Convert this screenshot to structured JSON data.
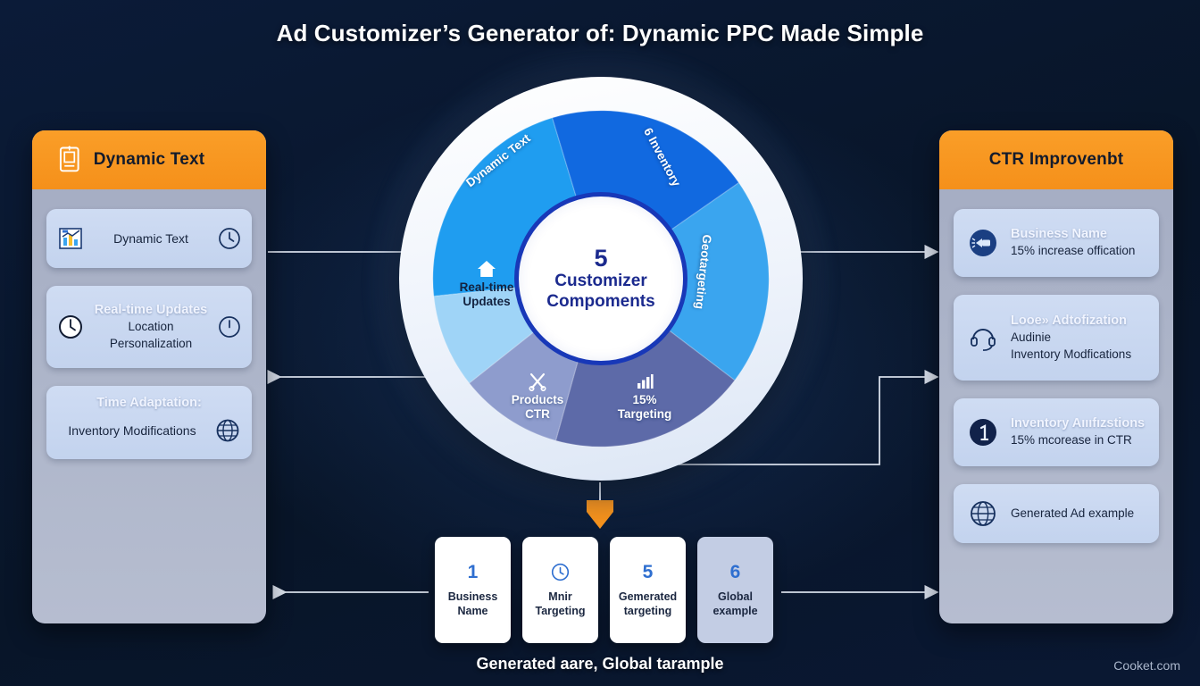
{
  "title": "Ad Customizer’s Generator of: Dynamic PPC Made Simple",
  "watermark": "Cooket.com",
  "colors": {
    "background": "#0a1833",
    "accent_orange": "#f7941e",
    "panel_body": "#a9b1c6",
    "card_blue": "#c8d7f0",
    "hub_border": "#1838b8",
    "hub_text": "#1b2a8e",
    "segment_1": "#1f9df0",
    "segment_2": "#1169e0",
    "segment_3": "#4fb3f2",
    "segment_4": "#5d6aa8",
    "segment_5": "#9fc9f0"
  },
  "left_panel": {
    "header": {
      "title": "Dynamic Text",
      "icon": "document-icon"
    },
    "cards": [
      {
        "id": "dynamic-text",
        "label": "Dynamic Text",
        "left_icon": "bar-chart-icon",
        "right_icon": "clock-icon"
      },
      {
        "id": "real-time-updates",
        "ghost_title": "Real-time Updates",
        "lines": [
          "Location",
          "Personalization"
        ],
        "left_icon": "clock-icon",
        "right_icon": "clock-icon"
      },
      {
        "id": "time-adaptation",
        "ghost_title": "Time Adaptation:",
        "lines": [
          "Inventory  Modifications"
        ],
        "right_icon": "globe-icon"
      }
    ]
  },
  "right_panel": {
    "header": {
      "title": "CTR Improvenbt"
    },
    "cards": [
      {
        "id": "business-name",
        "ghost_title": "Business Name",
        "lines": [
          "15% increase offication"
        ],
        "left_icon": "megaphone-icon"
      },
      {
        "id": "local-optimization",
        "ghost_title": "Looe» Adtofization",
        "lines": [
          "Audinie",
          "Inventory Modfications"
        ],
        "left_icon": "headset-icon"
      },
      {
        "id": "inventory-modifications",
        "ghost_title": "Inventory Aıııfızstions",
        "lines": [
          "15% mcorease in CTR"
        ],
        "left_icon": "number-one-badge-icon"
      },
      {
        "id": "generated-ad-example",
        "lines": [
          "Generated Ad example"
        ],
        "left_icon": "globe-icon"
      }
    ]
  },
  "center": {
    "hub_number": "5",
    "hub_line_1": "Customizer",
    "hub_line_2": "Compoments",
    "segments": [
      {
        "id": "dynamic-text",
        "label": "Dynamic Text",
        "value": 22,
        "color": "#1f9df0",
        "icon": ""
      },
      {
        "id": "inventory",
        "label": "6 Inventory",
        "value": 20,
        "color": "#1169e0",
        "icon": ""
      },
      {
        "id": "geotargeting",
        "label": "Geotargeting",
        "value": 20,
        "color": "#3aa5ef",
        "icon": ""
      },
      {
        "id": "targeting",
        "label": "15%\nTargeting",
        "value": 19,
        "color": "#5d6aa8",
        "icon": "bar-chart-icon"
      },
      {
        "id": "products-ctr",
        "label": "Products\nCTR",
        "value": 10,
        "color": "#8e9ccd",
        "icon": "scissors-icon"
      },
      {
        "id": "real-time-updates",
        "label": "Real-time\nUpdates",
        "value": 9,
        "color": "#9fd4f7",
        "icon": "home-icon"
      }
    ]
  },
  "chart_data": {
    "type": "pie",
    "title": "5 Customizer Compoments",
    "categories": [
      "Dynamic Text",
      "6 Inventory",
      "Geotargeting",
      "15% Targeting",
      "Products CTR",
      "Real-time Updates"
    ],
    "values": [
      22,
      20,
      20,
      19,
      10,
      9
    ],
    "colors": [
      "#1f9df0",
      "#1169e0",
      "#3aa5ef",
      "#5d6aa8",
      "#8e9ccd",
      "#9fd4f7"
    ],
    "legend": "none",
    "donut": true,
    "center_text": "5 Customizer Compoments"
  },
  "bottom": {
    "cards": [
      {
        "num": "1",
        "icon": "",
        "l1": "Business",
        "l2": "Name",
        "muted": false
      },
      {
        "num": "",
        "icon": "clock-icon",
        "l1": "Mnir",
        "l2": "Targeting",
        "muted": false
      },
      {
        "num": "5",
        "icon": "",
        "l1": "Gemerated",
        "l2": "targeting",
        "muted": false
      },
      {
        "num": "6",
        "icon": "",
        "l1": "Global",
        "l2": "example",
        "muted": true
      }
    ],
    "caption": "Generated aare, Global tarample"
  }
}
